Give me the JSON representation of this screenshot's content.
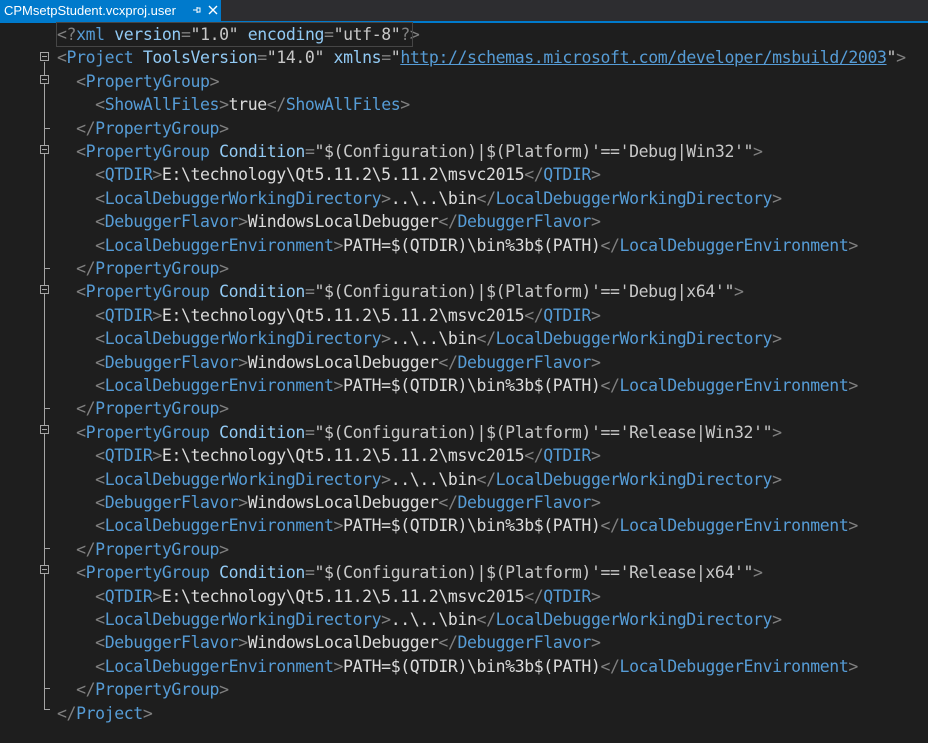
{
  "tab": {
    "title": "CPMsetpStudent.vcxproj.user",
    "pin_icon": "pin-icon",
    "close_icon": "close-icon"
  },
  "colors": {
    "accent": "#007acc",
    "background": "#1e1e1e",
    "tag": "#569cd6",
    "bracket": "#808080",
    "text": "#dcdcdc"
  },
  "xml_decl": {
    "open": "<?",
    "name": "xml",
    "version_attr": "version",
    "version_val": "\"1.0\"",
    "encoding_attr": "encoding",
    "encoding_val": "\"utf-8\"",
    "close": "?>"
  },
  "project": {
    "name": "Project",
    "tools_attr": "ToolsVersion",
    "tools_val": "\"14.0\"",
    "xmlns_attr": "xmlns",
    "xmlns_url": "http://schemas.microsoft.com/developer/msbuild/2003"
  },
  "first_group": {
    "name": "PropertyGroup",
    "child_name": "ShowAllFiles",
    "child_value": "true"
  },
  "condition_attr": "Condition",
  "groups": [
    {
      "condition": "\"$(Configuration)|$(Platform)'=='Debug|Win32'\"",
      "qtdir": "E:\\technology\\Qt5.11.2\\5.11.2\\msvc2015",
      "workdir": "..\\..\\bin",
      "flavor": "WindowsLocalDebugger",
      "env": "PATH=$(QTDIR)\\bin%3b$(PATH)"
    },
    {
      "condition": "\"$(Configuration)|$(Platform)'=='Debug|x64'\"",
      "qtdir": "E:\\technology\\Qt5.11.2\\5.11.2\\msvc2015",
      "workdir": "..\\..\\bin",
      "flavor": "WindowsLocalDebugger",
      "env": "PATH=$(QTDIR)\\bin%3b$(PATH)"
    },
    {
      "condition": "\"$(Configuration)|$(Platform)'=='Release|Win32'\"",
      "qtdir": "E:\\technology\\Qt5.11.2\\5.11.2\\msvc2015",
      "workdir": "..\\..\\bin",
      "flavor": "WindowsLocalDebugger",
      "env": "PATH=$(QTDIR)\\bin%3b$(PATH)"
    },
    {
      "condition": "\"$(Configuration)|$(Platform)'=='Release|x64'\"",
      "qtdir": "E:\\technology\\Qt5.11.2\\5.11.2\\msvc2015",
      "workdir": "..\\..\\bin",
      "flavor": "WindowsLocalDebugger",
      "env": "PATH=$(QTDIR)\\bin%3b$(PATH)"
    }
  ],
  "tags": {
    "property_group": "PropertyGroup",
    "qtdir": "QTDIR",
    "workdir": "LocalDebuggerWorkingDirectory",
    "flavor": "DebuggerFlavor",
    "env": "LocalDebuggerEnvironment"
  }
}
